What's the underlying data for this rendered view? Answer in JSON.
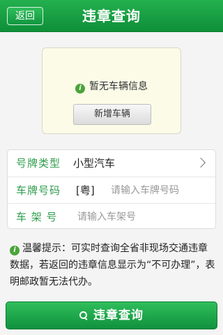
{
  "header": {
    "back_label": "返回",
    "title": "违章查询"
  },
  "empty_state": {
    "icon": "info-icon",
    "message": "暂无车辆信息",
    "add_button_label": "新增车辆"
  },
  "form": {
    "plate_type": {
      "label": "号牌类型",
      "value": "小型汽车",
      "icon": "chevron-right-icon"
    },
    "plate_number": {
      "label": "车牌号码",
      "prefix": "[粤]",
      "value": "",
      "placeholder": "请输入车牌号码"
    },
    "frame_number": {
      "label": "车 架 号",
      "value": "",
      "placeholder": "请输入车架号"
    }
  },
  "tip": {
    "icon": "info-icon",
    "text": "温馨提示：可实时查询全省非现场交通违章数据，若返回的违章信息显示为“不可办理”，表明邮政暂无法代办。"
  },
  "query_button": {
    "icon": "search-icon",
    "label": "违章查询"
  },
  "colors": {
    "brand_green": "#1aa046",
    "label_green": "#2e9d4c",
    "info_icon": "#4aa43a"
  }
}
